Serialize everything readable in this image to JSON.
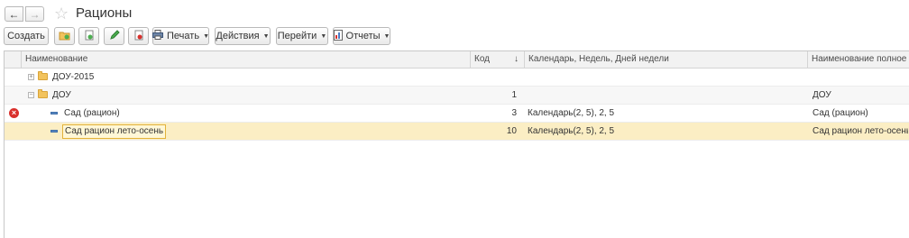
{
  "window": {
    "title": "Рационы"
  },
  "toolbar": {
    "create_label": "Создать",
    "print_label": "Печать",
    "actions_label": "Действия",
    "goto_label": "Перейти",
    "reports_label": "Отчеты"
  },
  "table": {
    "columns": {
      "name": "Наименование",
      "code": "Код",
      "sort": "↓",
      "calendar": "Календарь, Недель, Дней недели",
      "fullname": "Наименование полное"
    },
    "rows": [
      {
        "name": "ДОУ-2015",
        "code": "",
        "calendar": "",
        "fullname": ""
      },
      {
        "name": "ДОУ",
        "code": "1",
        "calendar": "",
        "fullname": "ДОУ"
      },
      {
        "name": "Сад (рацион)",
        "code": "3",
        "calendar": "Календарь(2, 5), 2, 5",
        "fullname": "Сад (рацион)"
      },
      {
        "name": "Сад рацион лето-осень",
        "code": "10",
        "calendar": "Календарь(2, 5), 2, 5",
        "fullname": "Сад рацион лето-осень"
      }
    ]
  },
  "colors": {
    "selected_row": "#fbeec4",
    "folder": "#f2c35d",
    "error": "#d9302c"
  }
}
